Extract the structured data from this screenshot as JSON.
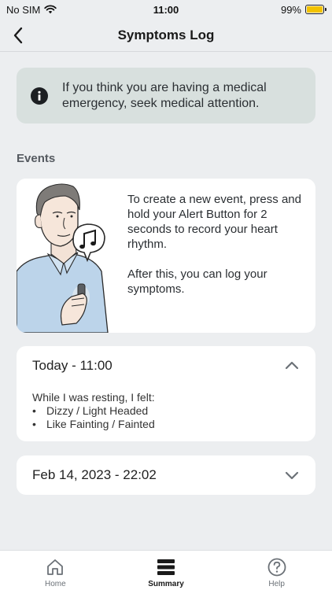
{
  "status_bar": {
    "carrier": "No SIM",
    "time": "11:00",
    "battery": "99%",
    "battery_level": 0.99,
    "battery_color": "#f2c200"
  },
  "nav": {
    "title": "Symptoms Log",
    "back_icon": "chevron-left-icon"
  },
  "alert": {
    "icon": "info-icon",
    "text": "If you think you are having a medical emergency, seek medical attention.",
    "background": "#d8e0de"
  },
  "events_section": {
    "label": "Events"
  },
  "info_card": {
    "paragraph_1": "To create a new event, press and hold your Alert Button for 2 seconds to record your heart rhythm.",
    "paragraph_2": "After this, you can log your symptoms."
  },
  "events": [
    {
      "title": "Today - 11:00",
      "expanded": true,
      "icon": "chevron-up-icon",
      "intro": "While I was resting, I felt:",
      "symptoms": [
        "Dizzy / Light Headed",
        "Like Fainting / Fainted"
      ]
    },
    {
      "title": "Feb 14, 2023 - 22:02",
      "expanded": false,
      "icon": "chevron-down-icon"
    }
  ],
  "tab_bar": {
    "tabs": [
      {
        "label": "Home",
        "icon": "home-icon",
        "active": false
      },
      {
        "label": "Summary",
        "icon": "summary-icon",
        "active": true
      },
      {
        "label": "Help",
        "icon": "help-icon",
        "active": false
      }
    ]
  }
}
